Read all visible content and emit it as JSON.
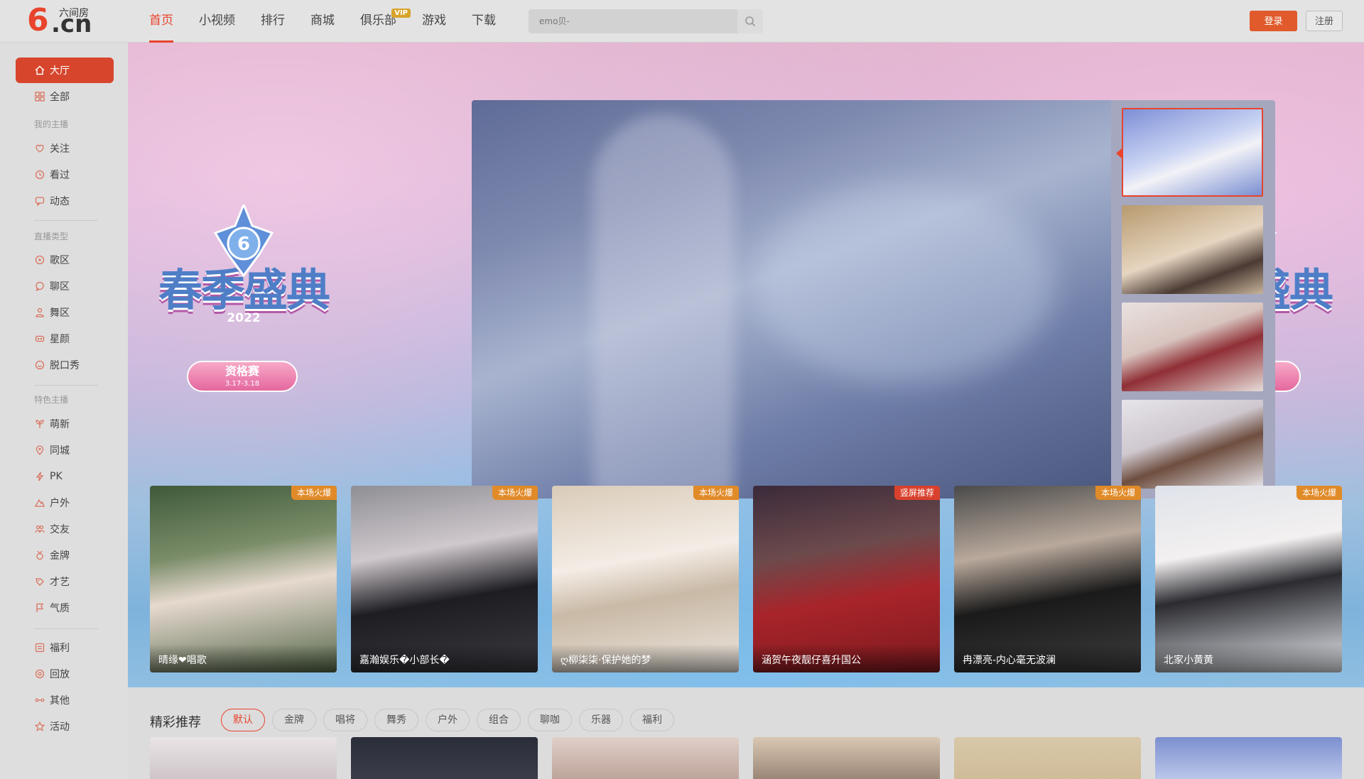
{
  "header": {
    "logo": {
      "mark": "6",
      "suffix": ".cn",
      "brand": "六间房"
    },
    "nav": [
      {
        "label": "首页",
        "active": true
      },
      {
        "label": "小视频"
      },
      {
        "label": "排行"
      },
      {
        "label": "商城"
      },
      {
        "label": "俱乐部",
        "badge": "VIP"
      },
      {
        "label": "游戏"
      },
      {
        "label": "下载"
      }
    ],
    "search": {
      "placeholder": "emo贝-",
      "icon": "search-icon"
    },
    "login_label": "登录",
    "register_label": "注册"
  },
  "sidebar": {
    "top": [
      {
        "label": "大厅",
        "icon": "home-icon",
        "active": true
      },
      {
        "label": "全部",
        "icon": "grid-icon"
      }
    ],
    "groups": [
      {
        "title": "我的主播",
        "items": [
          {
            "label": "关注",
            "icon": "heart-icon"
          },
          {
            "label": "看过",
            "icon": "clock-icon"
          },
          {
            "label": "动态",
            "icon": "chat-icon"
          }
        ]
      },
      {
        "title": "直播类型",
        "items": [
          {
            "label": "歌区",
            "icon": "music-icon"
          },
          {
            "label": "聊区",
            "icon": "bubble-icon"
          },
          {
            "label": "舞区",
            "icon": "dancer-icon"
          },
          {
            "label": "星颜",
            "icon": "mask-icon"
          },
          {
            "label": "脱口秀",
            "icon": "mic-icon"
          }
        ]
      },
      {
        "title": "特色主播",
        "items": [
          {
            "label": "萌新",
            "icon": "sprout-icon"
          },
          {
            "label": "同城",
            "icon": "location-icon"
          },
          {
            "label": "PK",
            "icon": "lightning-icon"
          },
          {
            "label": "户外",
            "icon": "mountain-icon"
          },
          {
            "label": "交友",
            "icon": "people-icon"
          },
          {
            "label": "金牌",
            "icon": "medal-icon"
          },
          {
            "label": "才艺",
            "icon": "palette-icon"
          },
          {
            "label": "气质",
            "icon": "flag-icon"
          }
        ]
      }
    ],
    "bottom": [
      {
        "label": "福利",
        "icon": "gift-icon"
      },
      {
        "label": "回放",
        "icon": "replay-icon"
      },
      {
        "label": "其他",
        "icon": "dots-icon"
      },
      {
        "label": "活动",
        "icon": "star-icon"
      }
    ]
  },
  "banner": {
    "event": {
      "title": "春季盛典",
      "year": "2022",
      "stage": "资格赛",
      "dates": "3.17-3.18"
    },
    "featured": [
      {
        "name": "晴缘❤唱歌",
        "tag": "本场火爆",
        "tag_color": "#e08a28"
      },
      {
        "name": "嘉瀚娱乐�小部长�",
        "tag": "本场火爆",
        "tag_color": "#e08a28"
      },
      {
        "name": "ღ柳柒柒·保护她的梦",
        "tag": "本场火爆",
        "tag_color": "#e08a28"
      },
      {
        "name": "涵贺午夜靓仔喜升国公",
        "tag": "竖屏推荐",
        "tag_color": "#d9412d"
      },
      {
        "name": "冉漂亮-内心毫无波澜",
        "tag": "本场火爆",
        "tag_color": "#e08a28"
      },
      {
        "name": "北家小黄黄",
        "tag": "本场火爆",
        "tag_color": "#e08a28"
      }
    ]
  },
  "recommend": {
    "title": "精彩推荐",
    "filters": [
      {
        "label": "默认",
        "active": true
      },
      {
        "label": "金牌"
      },
      {
        "label": "唱将"
      },
      {
        "label": "舞秀"
      },
      {
        "label": "户外"
      },
      {
        "label": "组合"
      },
      {
        "label": "聊咖"
      },
      {
        "label": "乐器"
      },
      {
        "label": "福利"
      }
    ]
  },
  "colors": {
    "accent": "#e8442d",
    "login": "#e05a2b",
    "sidebar_active": "#d6452c",
    "tag_hot": "#e08a28",
    "tag_vertical": "#d9412d"
  }
}
